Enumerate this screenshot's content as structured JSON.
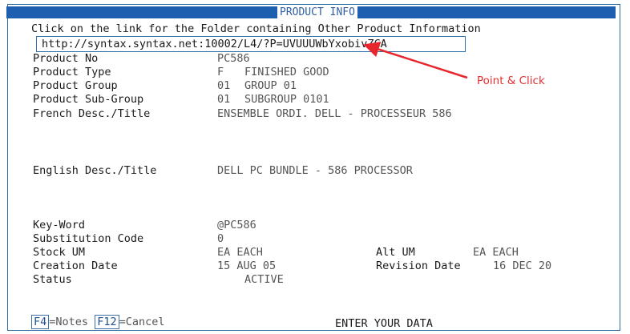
{
  "window": {
    "title": "PRODUCT INFO",
    "instruction": "Click on the link for the Folder containing Other Product Information",
    "link_url": "http://syntax.syntax.net:10002/L4/?P=UVUUUWbYxobivZCA"
  },
  "annotation": {
    "text": "Point & Click",
    "color": "#e33030"
  },
  "fields": {
    "product_no": {
      "label": "Product No",
      "value": "PC586"
    },
    "product_type": {
      "label": "Product Type",
      "code": "F",
      "value": "FINISHED GOOD"
    },
    "product_group": {
      "label": "Product Group",
      "code": "01",
      "value": "GROUP 01"
    },
    "product_subgroup": {
      "label": "Product Sub-Group",
      "code": "01",
      "value": "SUBGROUP 0101"
    },
    "french_desc": {
      "label": "French Desc./Title",
      "value": "ENSEMBLE ORDI. DELL - PROCESSEUR 586"
    },
    "english_desc": {
      "label": "English Desc./Title",
      "value": "DELL PC BUNDLE - 586 PROCESSOR"
    },
    "key_word": {
      "label": "Key-Word",
      "value": "@PC586"
    },
    "substitution_code": {
      "label": "Substitution Code",
      "value": "0"
    },
    "stock_um": {
      "label": "Stock UM",
      "value": "EA EACH"
    },
    "alt_um": {
      "label": "Alt UM",
      "value": "EA EACH"
    },
    "creation_date": {
      "label": "Creation Date",
      "value": "15 AUG 05"
    },
    "revision_date": {
      "label": "Revision Date",
      "value": "16 DEC 20"
    },
    "status": {
      "label": "Status",
      "value": "ACTIVE"
    }
  },
  "footer": {
    "f4_key": "F4",
    "f4_label": "=Notes",
    "f12_key": "F12",
    "f12_label": "=Cancel",
    "prompt": "ENTER YOUR DATA"
  }
}
